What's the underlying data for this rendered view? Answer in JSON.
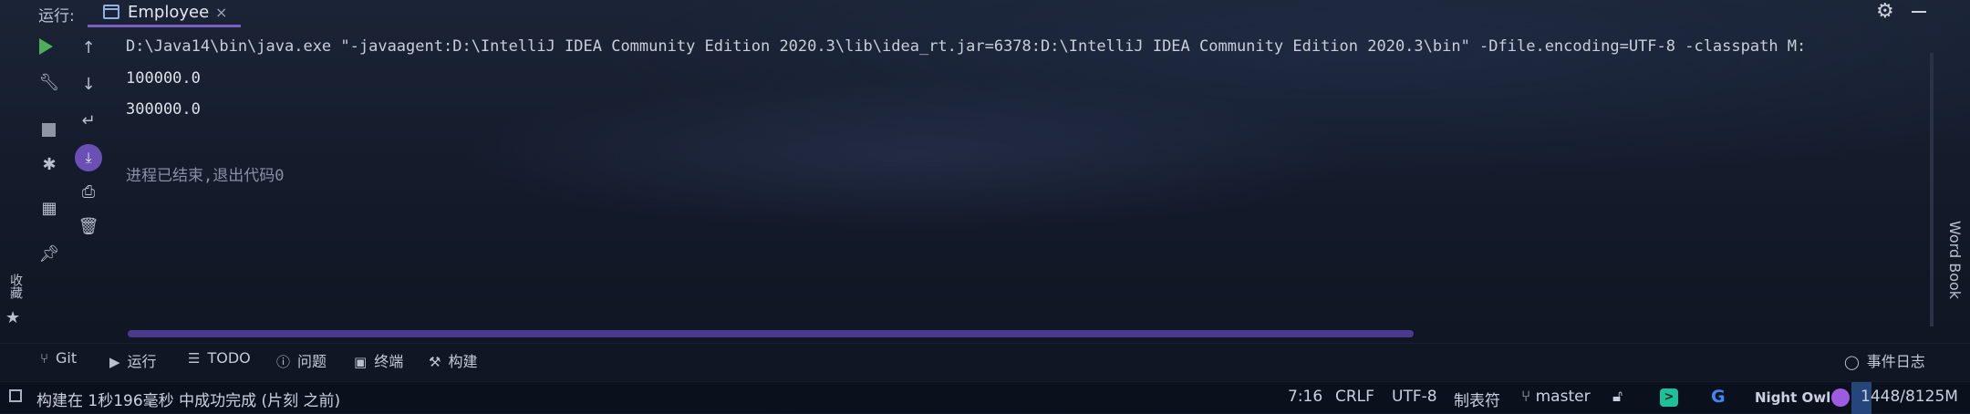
{
  "run_panel": {
    "label": "运行:",
    "tab": {
      "title": "Employee",
      "close": "×"
    },
    "icons": [
      "settings-gear-icon",
      "minimize-icon"
    ]
  },
  "left_toolbar": {
    "column1": [
      "run-icon",
      "wrench-icon",
      "stop-icon",
      "debug-icon",
      "layout-icon",
      "pin-icon"
    ],
    "column2": [
      "up-arrow-icon",
      "down-arrow-icon",
      "soft-wrap-icon",
      "scroll-to-end-icon",
      "print-icon",
      "trash-icon"
    ]
  },
  "console": {
    "command": "D:\\Java14\\bin\\java.exe \"-javaagent:D:\\IntelliJ IDEA Community Edition 2020.3\\lib\\idea_rt.jar=6378:D:\\IntelliJ IDEA Community Edition 2020.3\\bin\" -Dfile.encoding=UTF-8 -classpath M:",
    "output": [
      "100000.0",
      "300000.0"
    ],
    "exit_message": "进程已结束,退出代码0"
  },
  "side_labels": {
    "word_book": "Word Book",
    "favorites": "收藏"
  },
  "tool_tabs": [
    {
      "label": "Git",
      "icon": "git-branch-icon"
    },
    {
      "label": "运行",
      "icon": "run-triangle-icon"
    },
    {
      "label": "TODO",
      "icon": "list-icon"
    },
    {
      "label": "问题",
      "icon": "info-icon"
    },
    {
      "label": "终端",
      "icon": "terminal-icon"
    },
    {
      "label": "构建",
      "icon": "hammer-icon"
    }
  ],
  "event_log": "事件日志",
  "status_bar": {
    "message": "构建在 1秒196毫秒 中成功完成 (片刻 之前)",
    "position": "7:16",
    "line_separator": "CRLF",
    "encoding": "UTF-8",
    "indent": "制表符",
    "branch": "master",
    "theme": "Night Owl",
    "memory": "1448/8125M"
  }
}
